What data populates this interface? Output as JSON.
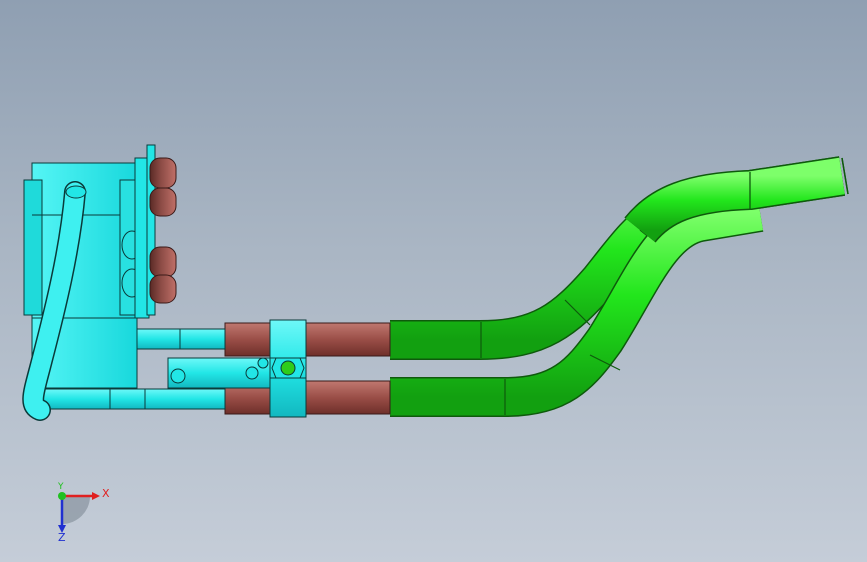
{
  "viewport": {
    "background_top": "#8f9fb2",
    "background_bottom": "#c5cdd8"
  },
  "model": {
    "colors": {
      "body": "#22e6e6",
      "body_shade": "#10b8c0",
      "edge": "#0a2a2a",
      "hose": "#9a4e47",
      "hose_shade": "#6e2f2a",
      "pipe_green": "#22e61c",
      "pipe_green_shade": "#14a812",
      "fitting": "#8a4a44",
      "nut_center": "#2ecc1a"
    }
  },
  "triad": {
    "x_label": "X",
    "y_label": "Y",
    "z_label": "Z",
    "x_color": "#e02020",
    "y_color": "#20c020",
    "z_color": "#2030d0"
  }
}
